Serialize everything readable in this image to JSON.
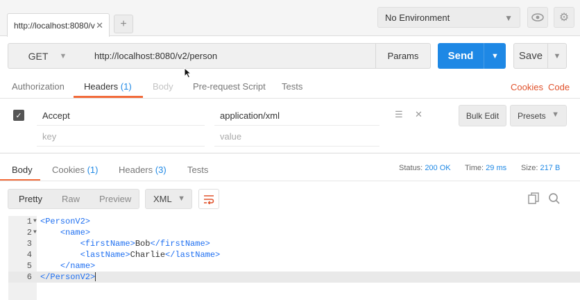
{
  "tabs": [
    {
      "label": "http://localhost:8080/v"
    }
  ],
  "environment": {
    "selected": "No Environment"
  },
  "request": {
    "method": "GET",
    "url": "http://localhost:8080/v2/person",
    "params_label": "Params",
    "send_label": "Send",
    "save_label": "Save"
  },
  "request_tabs": {
    "authorization": "Authorization",
    "headers": "Headers",
    "headers_count": "(1)",
    "body": "Body",
    "prerequest": "Pre-request Script",
    "tests": "Tests",
    "cookies": "Cookies",
    "code": "Code"
  },
  "headers_table": {
    "rows": [
      {
        "key": "Accept",
        "value": "application/xml",
        "checked": true
      }
    ],
    "key_placeholder": "key",
    "value_placeholder": "value",
    "bulk_edit_label": "Bulk Edit",
    "presets_label": "Presets"
  },
  "response": {
    "tabs": {
      "body": "Body",
      "cookies": "Cookies",
      "cookies_count": "(1)",
      "headers": "Headers",
      "headers_count": "(3)",
      "tests": "Tests"
    },
    "status_label": "Status:",
    "status_value": "200 OK",
    "time_label": "Time:",
    "time_value": "29 ms",
    "size_label": "Size:",
    "size_value": "217 B",
    "view_modes": {
      "pretty": "Pretty",
      "raw": "Raw",
      "preview": "Preview"
    },
    "format": "XML",
    "body_lines": [
      {
        "num": "1",
        "indent": "",
        "open": "<PersonV2>",
        "text": "",
        "close": ""
      },
      {
        "num": "2",
        "indent": "    ",
        "open": "<name>",
        "text": "",
        "close": ""
      },
      {
        "num": "3",
        "indent": "        ",
        "open": "<firstName>",
        "text": "Bob",
        "close": "</firstName>"
      },
      {
        "num": "4",
        "indent": "        ",
        "open": "<lastName>",
        "text": "Charlie",
        "close": "</lastName>"
      },
      {
        "num": "5",
        "indent": "    ",
        "open": "</name>",
        "text": "",
        "close": ""
      },
      {
        "num": "6",
        "indent": "",
        "open": "</PersonV2>",
        "text": "",
        "close": ""
      }
    ]
  },
  "colors": {
    "accent": "#f26b3a",
    "send_blue": "#1e88e5",
    "link_red": "#e0522c",
    "xml_tag": "#1e6ff1"
  },
  "icons": [
    "close-icon",
    "plus-icon",
    "chevron-down-icon",
    "eye-icon",
    "gear-icon",
    "checkbox-checked-icon",
    "drag-handle-icon",
    "delete-icon",
    "wrap-lines-icon",
    "copy-icon",
    "search-icon",
    "mouse-cursor-icon"
  ]
}
